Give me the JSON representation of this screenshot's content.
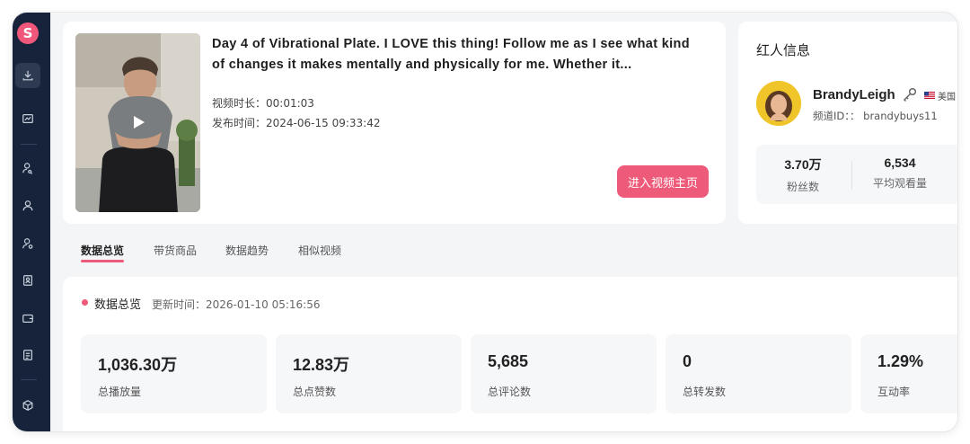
{
  "brand": {
    "logo_letter": "S",
    "accent": "#ee5a7a",
    "sidebar_bg": "#17233a"
  },
  "sidebar": {
    "items": [
      {
        "icon": "download-icon",
        "active": true
      },
      {
        "icon": "chart-icon"
      },
      {
        "icon": "user-search-icon"
      },
      {
        "icon": "user-icon"
      },
      {
        "icon": "user-settings-icon"
      },
      {
        "icon": "id-card-icon"
      },
      {
        "icon": "wallet-icon"
      },
      {
        "icon": "report-icon"
      },
      {
        "icon": "cube-icon"
      }
    ]
  },
  "video": {
    "title": "Day 4 of Vibrational Plate. I LOVE this thing! Follow me as I see what kind of changes it makes mentally and physically for me. Whether it...",
    "duration_label": "视频时长：",
    "duration": "00:01:03",
    "published_label": "发布时间：",
    "published": "2024-06-15 09:33:42",
    "open_button": "进入视频主页"
  },
  "influencer": {
    "section_title": "红人信息",
    "name": "BrandyLeigh",
    "country": "美国",
    "channel_label": "频道ID：：",
    "channel_id": "brandybuys11",
    "stats": [
      {
        "value": "3.70万",
        "label": "粉丝数"
      },
      {
        "value": "6,534",
        "label": "平均观看量"
      }
    ]
  },
  "tabs": [
    {
      "label": "数据总览",
      "active": true
    },
    {
      "label": "带货商品"
    },
    {
      "label": "数据趋势"
    },
    {
      "label": "相似视频"
    }
  ],
  "overview": {
    "title": "数据总览",
    "update_label": "更新时间：",
    "update_time": "2026-01-10 05:16:56",
    "metrics": [
      {
        "value": "1,036.30万",
        "label": "总播放量"
      },
      {
        "value": "12.83万",
        "label": "总点赞数"
      },
      {
        "value": "5,685",
        "label": "总评论数"
      },
      {
        "value": "0",
        "label": "总转发数"
      },
      {
        "value": "1.29%",
        "label": "互动率"
      }
    ]
  }
}
